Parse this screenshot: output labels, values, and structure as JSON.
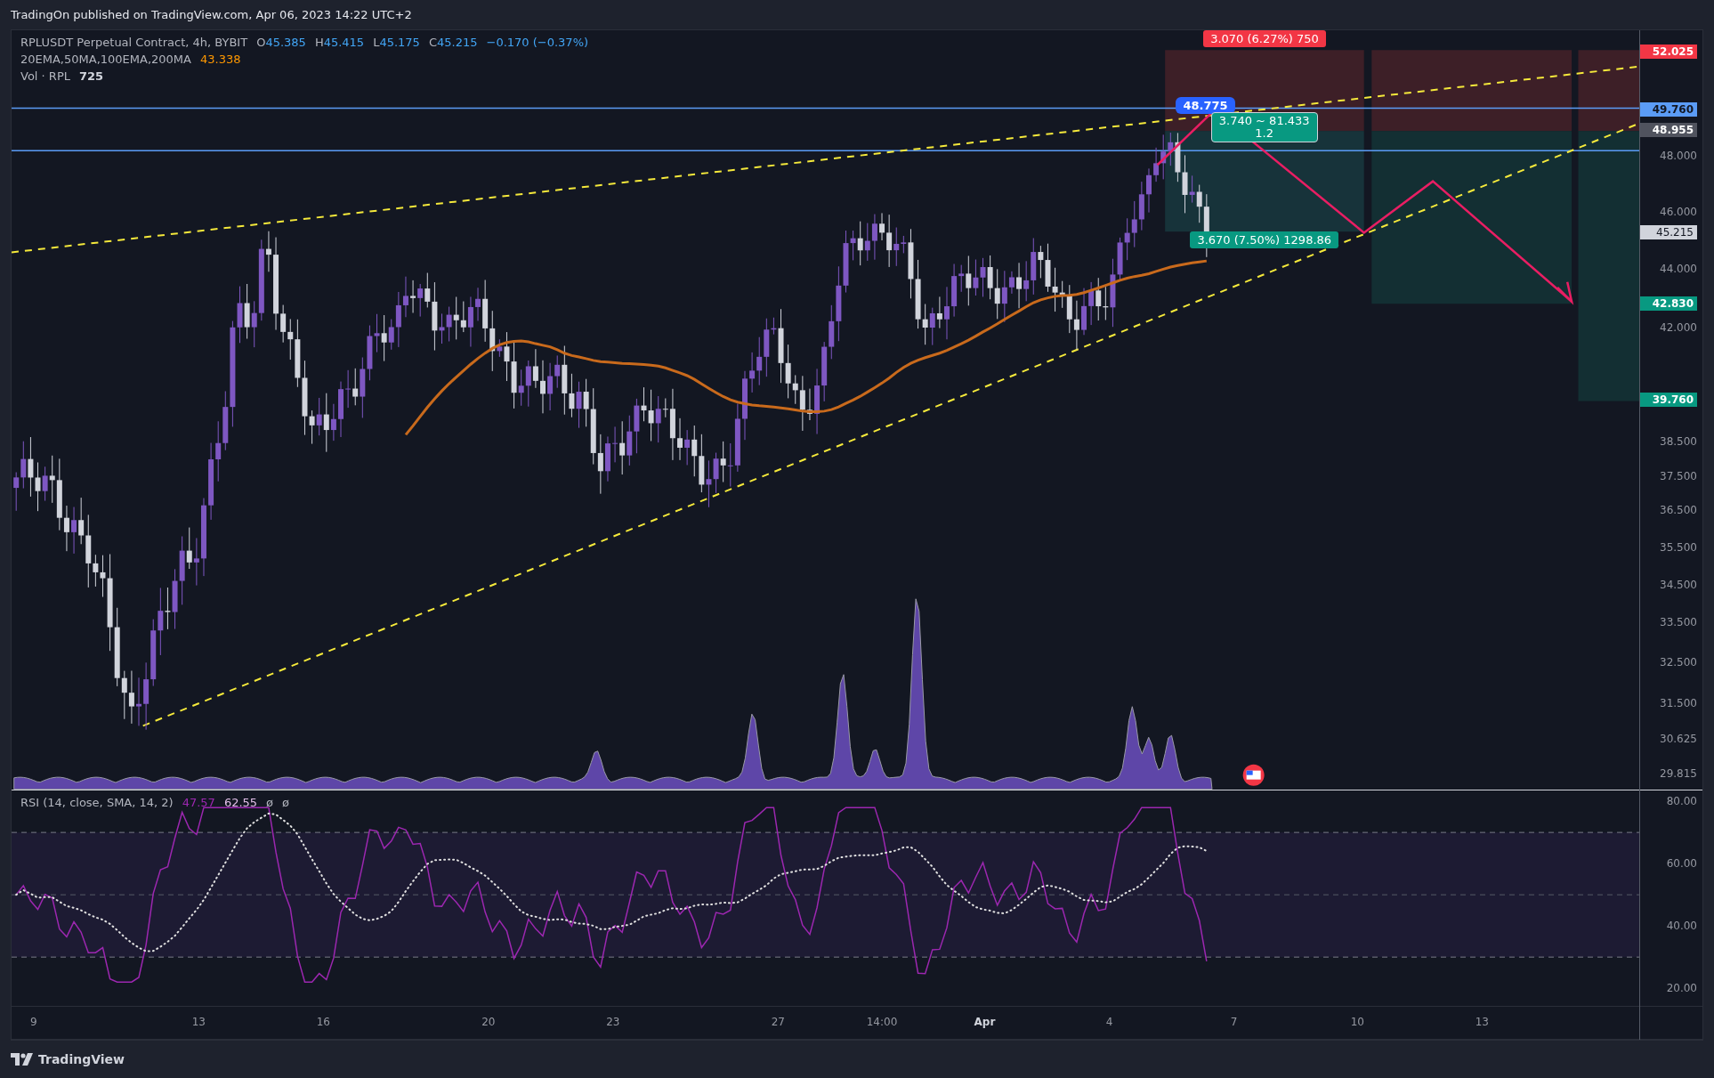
{
  "header": {
    "text": "TradingOn published on TradingView.com, Apr 06, 2023 14:22 UTC+2"
  },
  "legend": {
    "symbol": "RPLUSDT Perpetual Contract, 4h, BYBIT",
    "ohlc": [
      {
        "key": "O",
        "value": "45.385"
      },
      {
        "key": "H",
        "value": "45.415"
      },
      {
        "key": "L",
        "value": "45.175"
      },
      {
        "key": "C",
        "value": "45.215"
      }
    ],
    "change": "−0.170 (−0.37%)",
    "indicators": [
      {
        "name": "20EMA,50MA,100EMA,200MA",
        "value": "43.338",
        "kind": "ma"
      },
      {
        "name": "Vol · RPL",
        "value": "725",
        "kind": "volume"
      }
    ]
  },
  "chart_labels": [
    {
      "text": "3.070 (6.27%) 750",
      "kind": "stop"
    },
    {
      "text": "48.775",
      "kind": "callout"
    },
    {
      "text": "3.740 ~ 81.433",
      "second_line": "1.2",
      "kind": "ratio"
    },
    {
      "text": "3.670 (7.50%) 1298.86",
      "kind": "target"
    }
  ],
  "price_axis": {
    "ticks": [
      "48.000",
      "46.000",
      "44.000",
      "42.000",
      "38.500",
      "37.500",
      "36.500",
      "35.500",
      "34.500",
      "33.500",
      "32.500",
      "31.500",
      "30.625",
      "29.815"
    ],
    "tags": [
      {
        "text": "52.025",
        "kind": "stop"
      },
      {
        "text": "49.760",
        "kind": "level"
      },
      {
        "text": "48.955",
        "kind": "entry"
      },
      {
        "text": "45.215",
        "kind": "last"
      },
      {
        "text": "42.830",
        "kind": "target"
      },
      {
        "text": "39.760",
        "kind": "target"
      }
    ]
  },
  "rsi": {
    "title": "RSI (14, close, SMA, 14, 2)",
    "value": "47.57",
    "signal": "62.55",
    "extras": [
      "ø",
      "ø"
    ],
    "ticks": [
      "80.00",
      "60.00",
      "40.00",
      "20.00"
    ]
  },
  "time_axis": {
    "ticks": [
      {
        "label": "9",
        "bold": false
      },
      {
        "label": "13",
        "bold": false
      },
      {
        "label": "16",
        "bold": false
      },
      {
        "label": "20",
        "bold": false
      },
      {
        "label": "23",
        "bold": false
      },
      {
        "label": "27",
        "bold": false
      },
      {
        "label": "14:00",
        "bold": false
      },
      {
        "label": "Apr",
        "bold": true
      },
      {
        "label": "4",
        "bold": false
      },
      {
        "label": "7",
        "bold": false
      },
      {
        "label": "10",
        "bold": false
      },
      {
        "label": "13",
        "bold": false
      }
    ]
  },
  "footer": {
    "logo": "TradingView"
  }
}
